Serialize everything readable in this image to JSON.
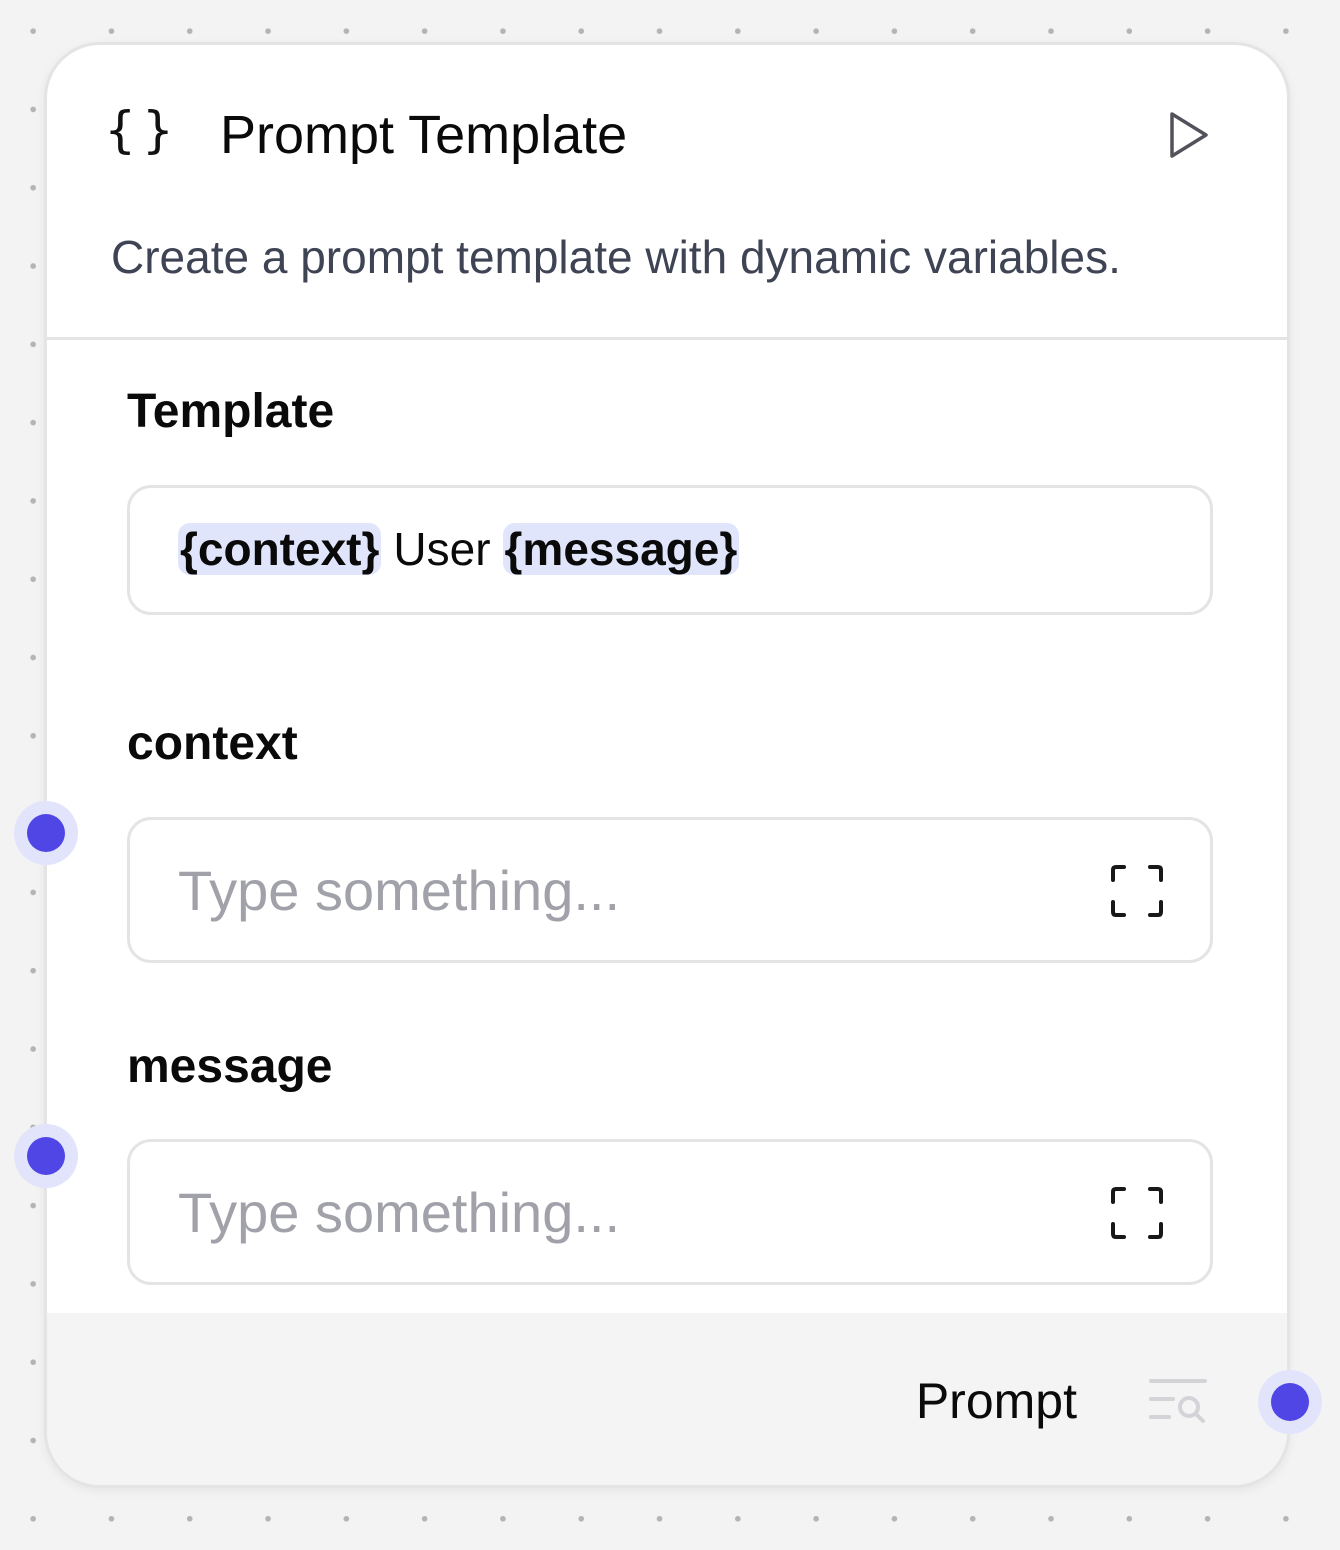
{
  "node": {
    "title": "Prompt Template",
    "description": "Create a prompt template with dynamic variables.",
    "icon": "curly-braces-icon",
    "icon_glyph": "{}",
    "run_icon": "play-icon"
  },
  "template_field": {
    "label": "Template",
    "value_parts": [
      {
        "text": "{context}",
        "variable": true
      },
      {
        "text": "User",
        "variable": false
      },
      {
        "text": "{message}",
        "variable": true
      }
    ]
  },
  "variable_fields": [
    {
      "label": "context",
      "placeholder": "Type something...",
      "value": "",
      "icon": "expand-icon"
    },
    {
      "label": "message",
      "placeholder": "Type something...",
      "value": "",
      "icon": "expand-icon"
    }
  ],
  "output": {
    "label": "Prompt",
    "icon": "inspect-output-icon"
  },
  "colors": {
    "accent": "#4f46e5",
    "handle_ring": "#e2e4fc",
    "variable_highlight": "#e0e5fb",
    "border": "#e4e4e7",
    "placeholder": "#a1a1aa",
    "canvas": "#f3f3f3"
  }
}
